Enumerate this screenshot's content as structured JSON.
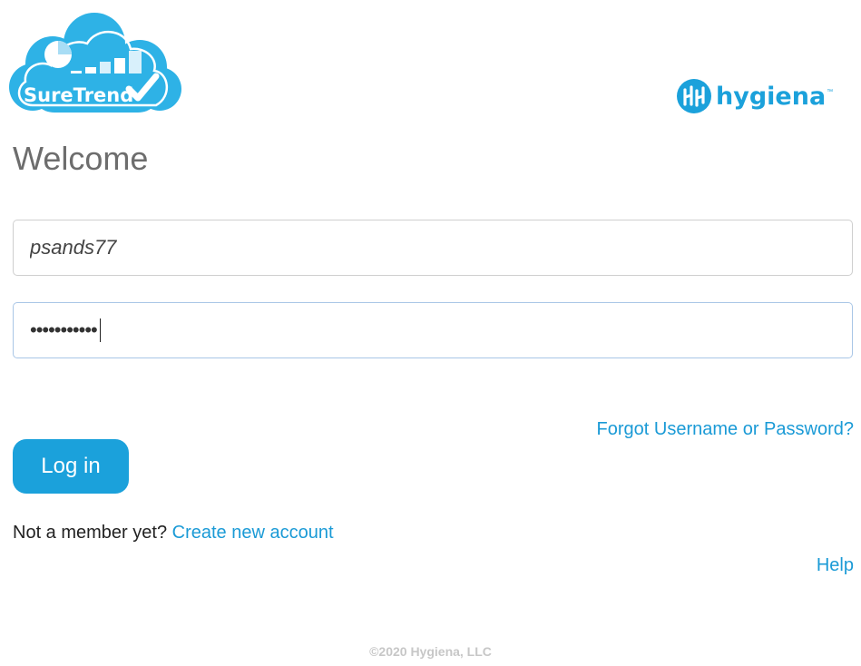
{
  "branding": {
    "suretrend_logo_text": "SureTrend",
    "hygiena_logo_text": "hygiena",
    "hygiena_trademark": "™",
    "brand_color": "#1ba1db"
  },
  "page": {
    "title": "Welcome"
  },
  "login_form": {
    "username_value": "psands77",
    "password_masked": "•••••••••••",
    "login_label": "Log in",
    "forgot_label": "Forgot Username or Password?"
  },
  "signup": {
    "prompt": "Not a member yet?",
    "link_label": "Create new account"
  },
  "help": {
    "label": "Help"
  },
  "footer": {
    "copyright": "©2020 Hygiena, LLC"
  }
}
